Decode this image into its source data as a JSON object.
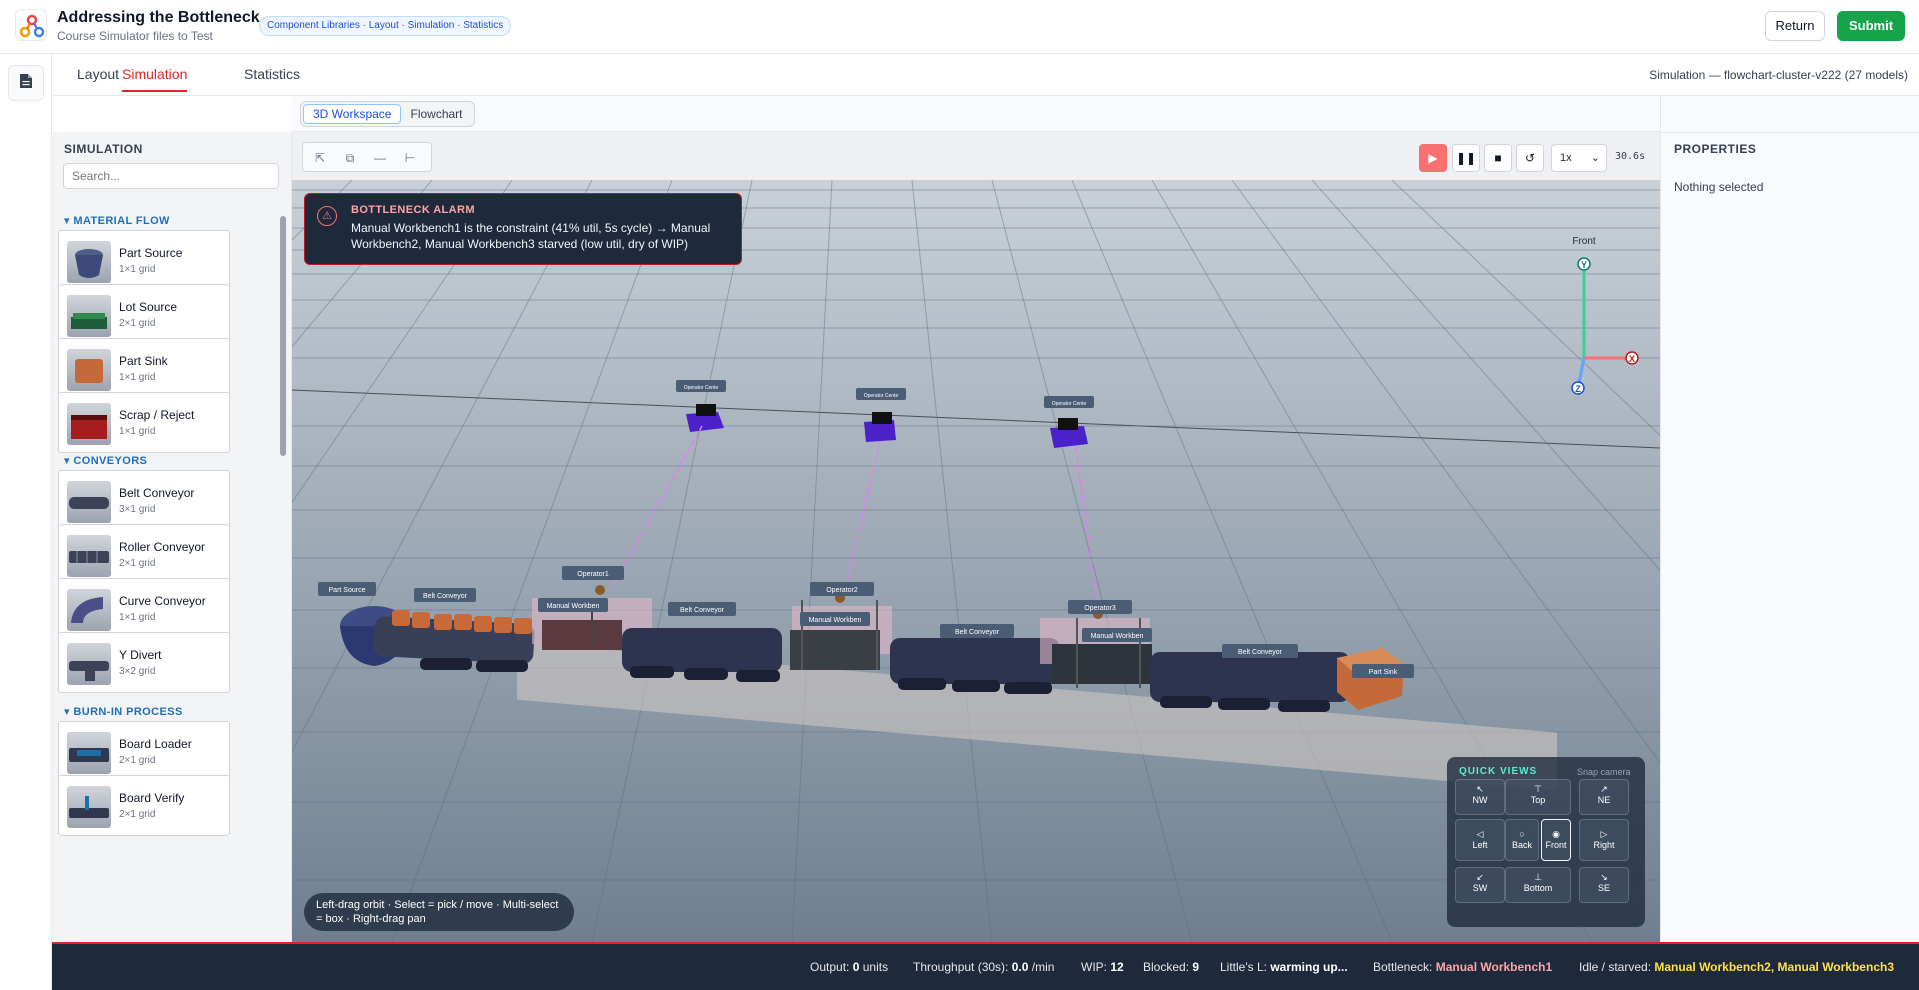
{
  "header": {
    "title": "Addressing the Bottleneck",
    "subtitle": "Course Simulator files to Test",
    "breadcrumb": "Component Libraries · Layout · Simulation · Statistics",
    "return_label": "Return",
    "submit_label": "Submit"
  },
  "tabs": {
    "layout": "Layout",
    "simulation": "Simulation",
    "statistics": "Statistics",
    "active": "Simulation"
  },
  "sim_meta": "Simulation — flowchart-cluster-v222 (27 models)",
  "view_toggle": {
    "workspace": "3D Workspace",
    "flowchart": "Flowchart",
    "active": "3D Workspace"
  },
  "palette": {
    "title": "SIMULATION",
    "search_placeholder": "Search...",
    "sections": {
      "material_flow": "MATERIAL FLOW",
      "conveyors": "CONVEYORS",
      "burn_in": "BURN-IN PROCESS"
    },
    "items": [
      {
        "name": "Part Source",
        "size": "1×1 grid"
      },
      {
        "name": "Lot Source",
        "size": "2×1 grid"
      },
      {
        "name": "Part Sink",
        "size": "1×1 grid"
      },
      {
        "name": "Scrap / Reject",
        "size": "1×1 grid"
      },
      {
        "name": "Belt Conveyor",
        "size": "3×1 grid"
      },
      {
        "name": "Roller Conveyor",
        "size": "2×1 grid"
      },
      {
        "name": "Curve Conveyor",
        "size": "1×1 grid"
      },
      {
        "name": "Y Divert",
        "size": "3×2 grid"
      },
      {
        "name": "Board Loader",
        "size": "2×1 grid"
      },
      {
        "name": "Board Verify",
        "size": "2×1 grid"
      }
    ]
  },
  "controls": {
    "speed": "1x",
    "time": "30.6s"
  },
  "alarm": {
    "title": "BOTTLENECK ALARM",
    "text": "Manual Workbench1 is the constraint (41% util, 5s cycle) → Manual Workbench2, Manual Workbench3 starved (low util, dry of WIP)"
  },
  "axes": {
    "front": "Front",
    "y": "Y",
    "x": "X",
    "z": "Z"
  },
  "scene_labels": {
    "part_source": "Part Source",
    "belt1": "Belt Conveyor",
    "operator1": "Operator1",
    "workbench1": "Manual Workben",
    "belt2": "Belt Conveyor",
    "operator2": "Operator2",
    "workbench2": "Manual Workben",
    "belt3": "Belt Conveyor",
    "operator3": "Operator3",
    "workbench3": "Manual Workben",
    "belt4": "Belt Conveyor",
    "part_sink": "Part Sink",
    "operator_cente": "Operator Cente"
  },
  "hint": "Left-drag orbit · Select = pick / move · Multi-select = box · Right-drag pan",
  "quick_views": {
    "title": "QUICK VIEWS",
    "subtitle": "Snap camera",
    "buttons": [
      "NW",
      "Top",
      "NE",
      "Left",
      "Back",
      "Front",
      "Right",
      "SW",
      "Bottom",
      "SE"
    ],
    "active": "Front"
  },
  "properties": {
    "title": "PROPERTIES",
    "empty": "Nothing selected"
  },
  "status": {
    "output_label": "Output:",
    "output_value": "0",
    "output_unit": "units",
    "throughput_label": "Throughput (30s):",
    "throughput_value": "0.0",
    "throughput_unit": "/min",
    "wip_label": "WIP:",
    "wip_value": "12",
    "blocked_label": "Blocked:",
    "blocked_value": "9",
    "little_label": "Little's L:",
    "little_value": "warming up...",
    "bottleneck_label": "Bottleneck:",
    "bottleneck_value": "Manual Workbench1",
    "idle_label": "Idle / starved:",
    "idle_value": "Manual Workbench2, Manual Workbench3"
  },
  "colors": {
    "accent": "#dc2626",
    "submit": "#16a34a",
    "link": "#1d4ed8",
    "section": "#1e6fb8"
  }
}
